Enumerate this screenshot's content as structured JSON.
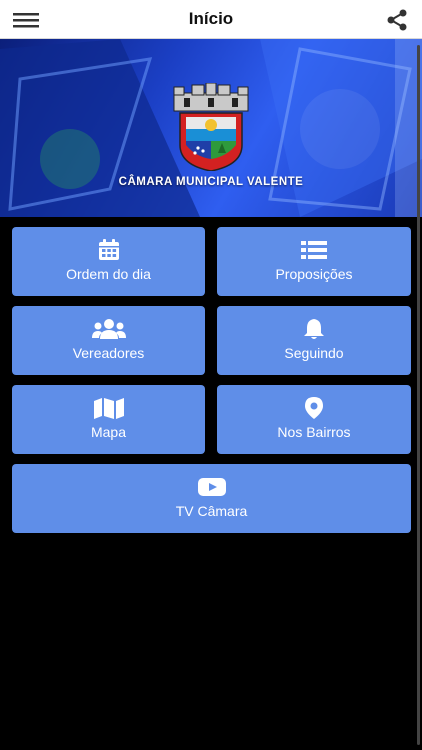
{
  "header": {
    "title": "Início"
  },
  "banner": {
    "org_name": "CÂMARA MUNICIPAL VALENTE"
  },
  "menu": [
    {
      "label": "Ordem do dia",
      "icon": "calendar-icon"
    },
    {
      "label": "Proposições",
      "icon": "list-icon"
    },
    {
      "label": "Vereadores",
      "icon": "users-icon"
    },
    {
      "label": "Seguindo",
      "icon": "bell-icon"
    },
    {
      "label": "Mapa",
      "icon": "map-icon"
    },
    {
      "label": "Nos Bairros",
      "icon": "map-pin-icon"
    },
    {
      "label": "TV Câmara",
      "icon": "youtube-icon"
    }
  ],
  "colors": {
    "tile": "#5f8ee8",
    "banner": "#1b3fc4",
    "background": "#000000"
  }
}
